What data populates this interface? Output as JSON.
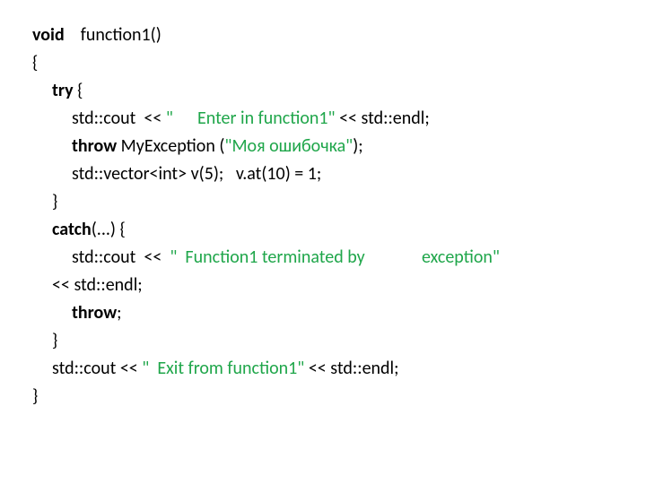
{
  "code": {
    "l1": {
      "kw": "void",
      "rest": "    function1()"
    },
    "l2": "{",
    "l3": {
      "kw": "try",
      "rest": " {"
    },
    "l4": {
      "a": "std::cout  << ",
      "s": "\"      Enter in function1\"",
      "b": " << std::endl;"
    },
    "l5": {
      "kw": "throw",
      "mid": " MyException (",
      "s": "\"Моя ошибочка\"",
      "end": ");"
    },
    "l6": "std::vector<int> v(5);   v.at(10) = 1;",
    "l7": "}",
    "l8": {
      "kw": "catch",
      "rest": "(...) {"
    },
    "l9": {
      "a": "std::cout  <<  ",
      "s": "\"  Function1 terminated by              exception\""
    },
    "l9b": "<< std::endl;",
    "l10": {
      "kw": "throw",
      "rest": ";"
    },
    "l11": "}",
    "l12": {
      "a": "std::cout << ",
      "s": "\"  Exit from function1\"",
      "b": " << std::endl;"
    },
    "l13": "}"
  }
}
